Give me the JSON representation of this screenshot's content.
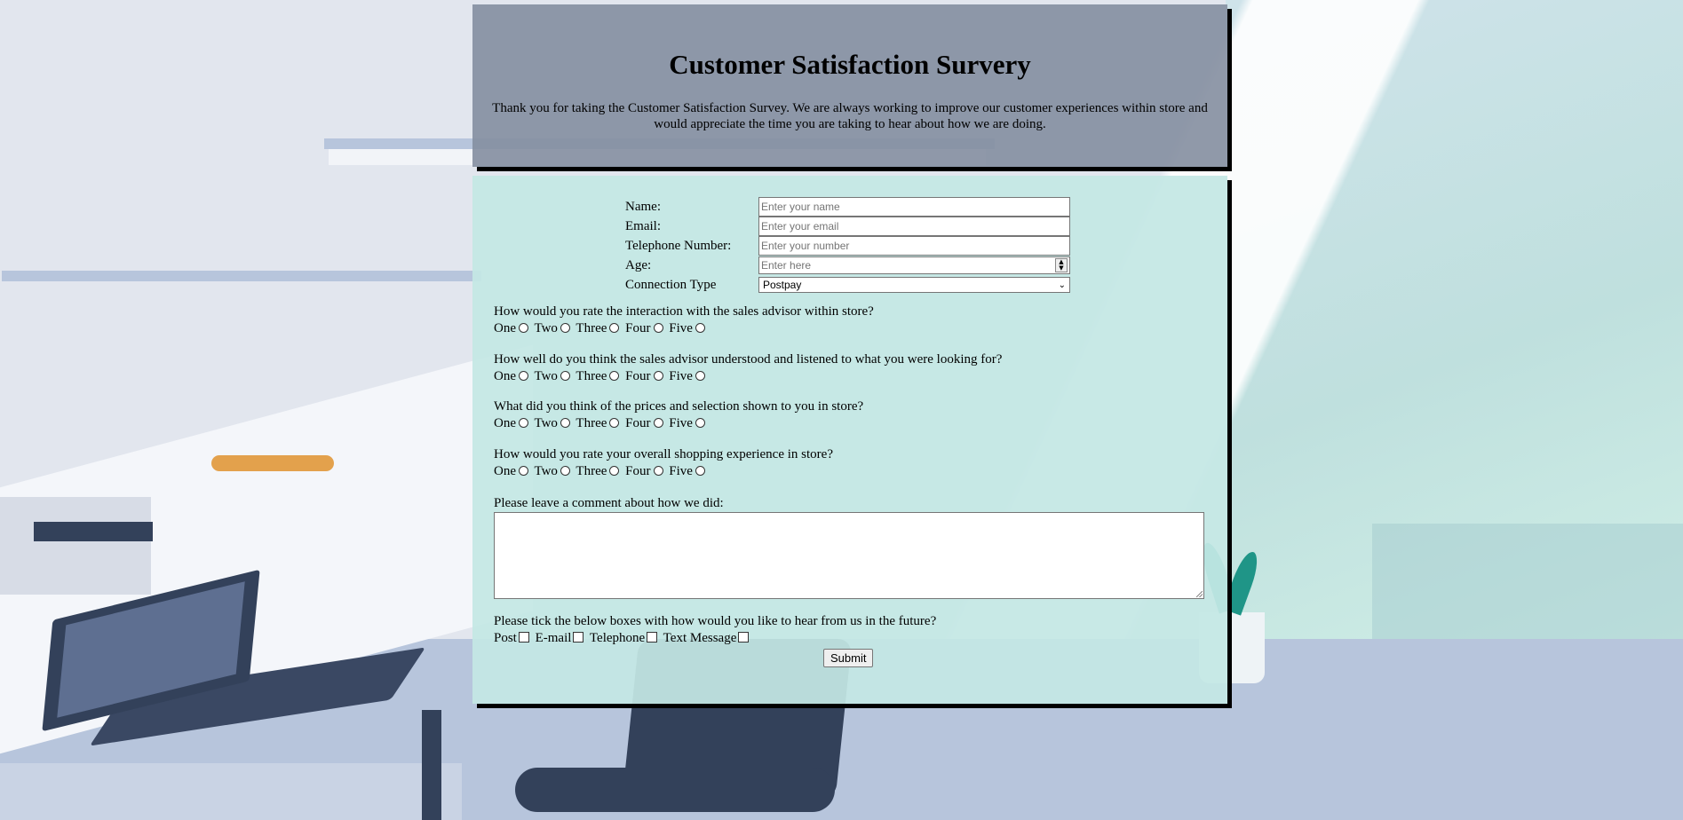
{
  "header": {
    "title": "Customer Satisfaction Survery",
    "intro": "Thank you for taking the Customer Satisfaction Survey. We are always working to improve our customer experiences within store and would appreciate the time you are taking to hear about how we are doing."
  },
  "fields": {
    "name": {
      "label": "Name:",
      "placeholder": "Enter your name"
    },
    "email": {
      "label": "Email:",
      "placeholder": "Enter your email"
    },
    "telephone": {
      "label": "Telephone Number:",
      "placeholder": "Enter your number"
    },
    "age": {
      "label": "Age:",
      "placeholder": "Enter here"
    },
    "connection": {
      "label": "Connection Type",
      "value": "Postpay"
    }
  },
  "rating_options": [
    "One",
    "Two",
    "Three",
    "Four",
    "Five"
  ],
  "questions": [
    "How would you rate the interaction with the sales advisor within store?",
    "How well do you think the sales advisor understood and listened to what you were looking for?",
    "What did you think of the prices and selection shown to you in store?",
    "How would you rate your overall shopping experience in store?"
  ],
  "comment": {
    "label": "Please leave a comment about how we did:",
    "value": ""
  },
  "contact": {
    "question": "Please tick the below boxes with how would you like to hear from us in the future?",
    "options": [
      "Post",
      "E-mail",
      "Telephone",
      "Text Message"
    ]
  },
  "submit_label": "Submit",
  "colors": {
    "header_panel": "#848ea0",
    "form_panel": "#c4e7e4",
    "panel_shadow": "#000000"
  }
}
